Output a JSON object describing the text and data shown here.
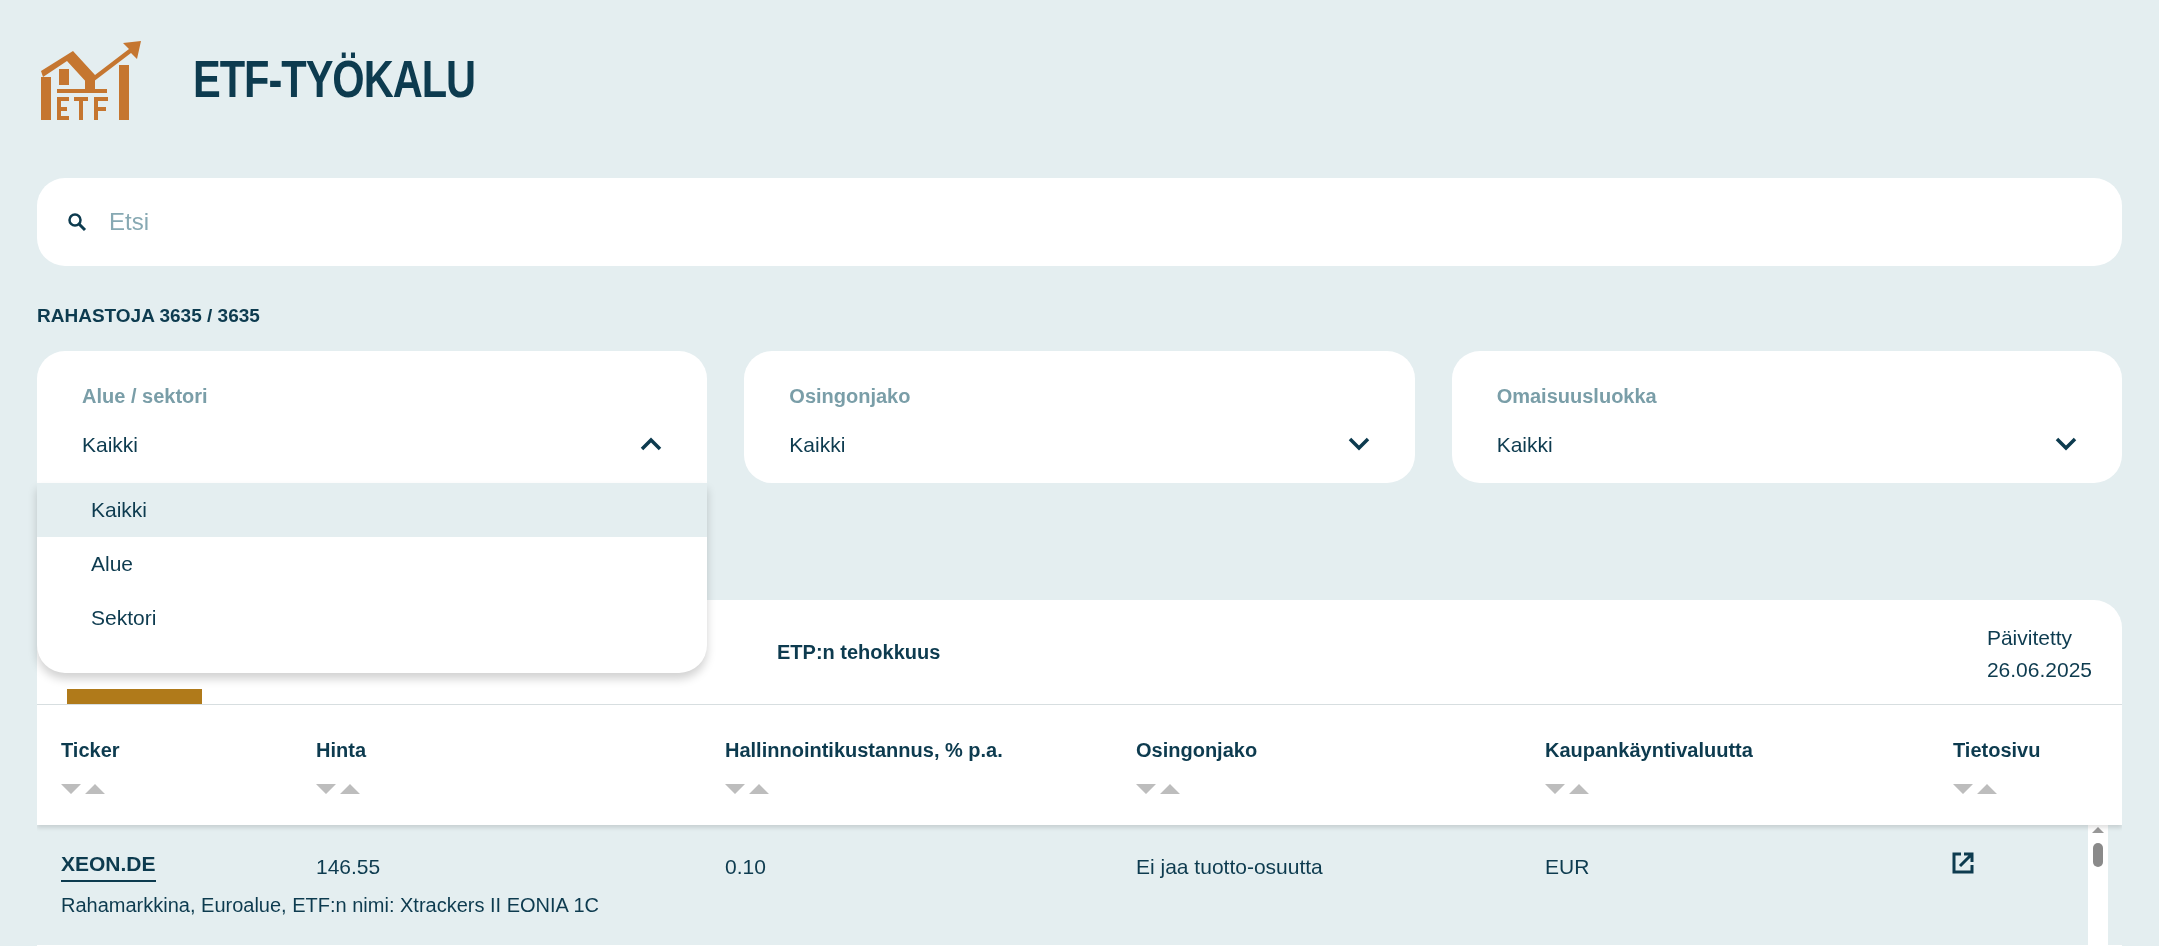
{
  "header": {
    "title": "ETF-TYÖKALU"
  },
  "search": {
    "placeholder": "Etsi"
  },
  "fund_count": "RAHASTOJA 3635 / 3635",
  "filters": [
    {
      "label": "Alue / sektori",
      "value": "Kaikki",
      "expanded": true,
      "options": [
        {
          "label": "Kaikki",
          "selected": true
        },
        {
          "label": "Alue",
          "selected": false
        },
        {
          "label": "Sektori",
          "selected": false
        }
      ]
    },
    {
      "label": "Osingonjako",
      "value": "Kaikki",
      "expanded": false
    },
    {
      "label": "Omaisuusluokka",
      "value": "Kaikki",
      "expanded": false
    }
  ],
  "table": {
    "tabs": [
      {
        "selected": true
      },
      {
        "label": "ETP:n tehokkuus",
        "selected": false
      }
    ],
    "updated": {
      "label": "Päivitetty",
      "date": "26.06.2025"
    },
    "columns": [
      "Ticker",
      "Hinta",
      "Hallinnointikustannus, % p.a.",
      "Osingonjako",
      "Kaupankäyntivaluutta",
      "Tietosivu"
    ],
    "rows": [
      {
        "ticker": "XEON.DE",
        "description": "Rahamarkkina, Euroalue, ETF:n nimi: Xtrackers II EONIA 1C",
        "price": "146.55",
        "fee": "0.10",
        "dividend": "Ei jaa tuotto-osuutta",
        "currency": "EUR"
      }
    ]
  }
}
